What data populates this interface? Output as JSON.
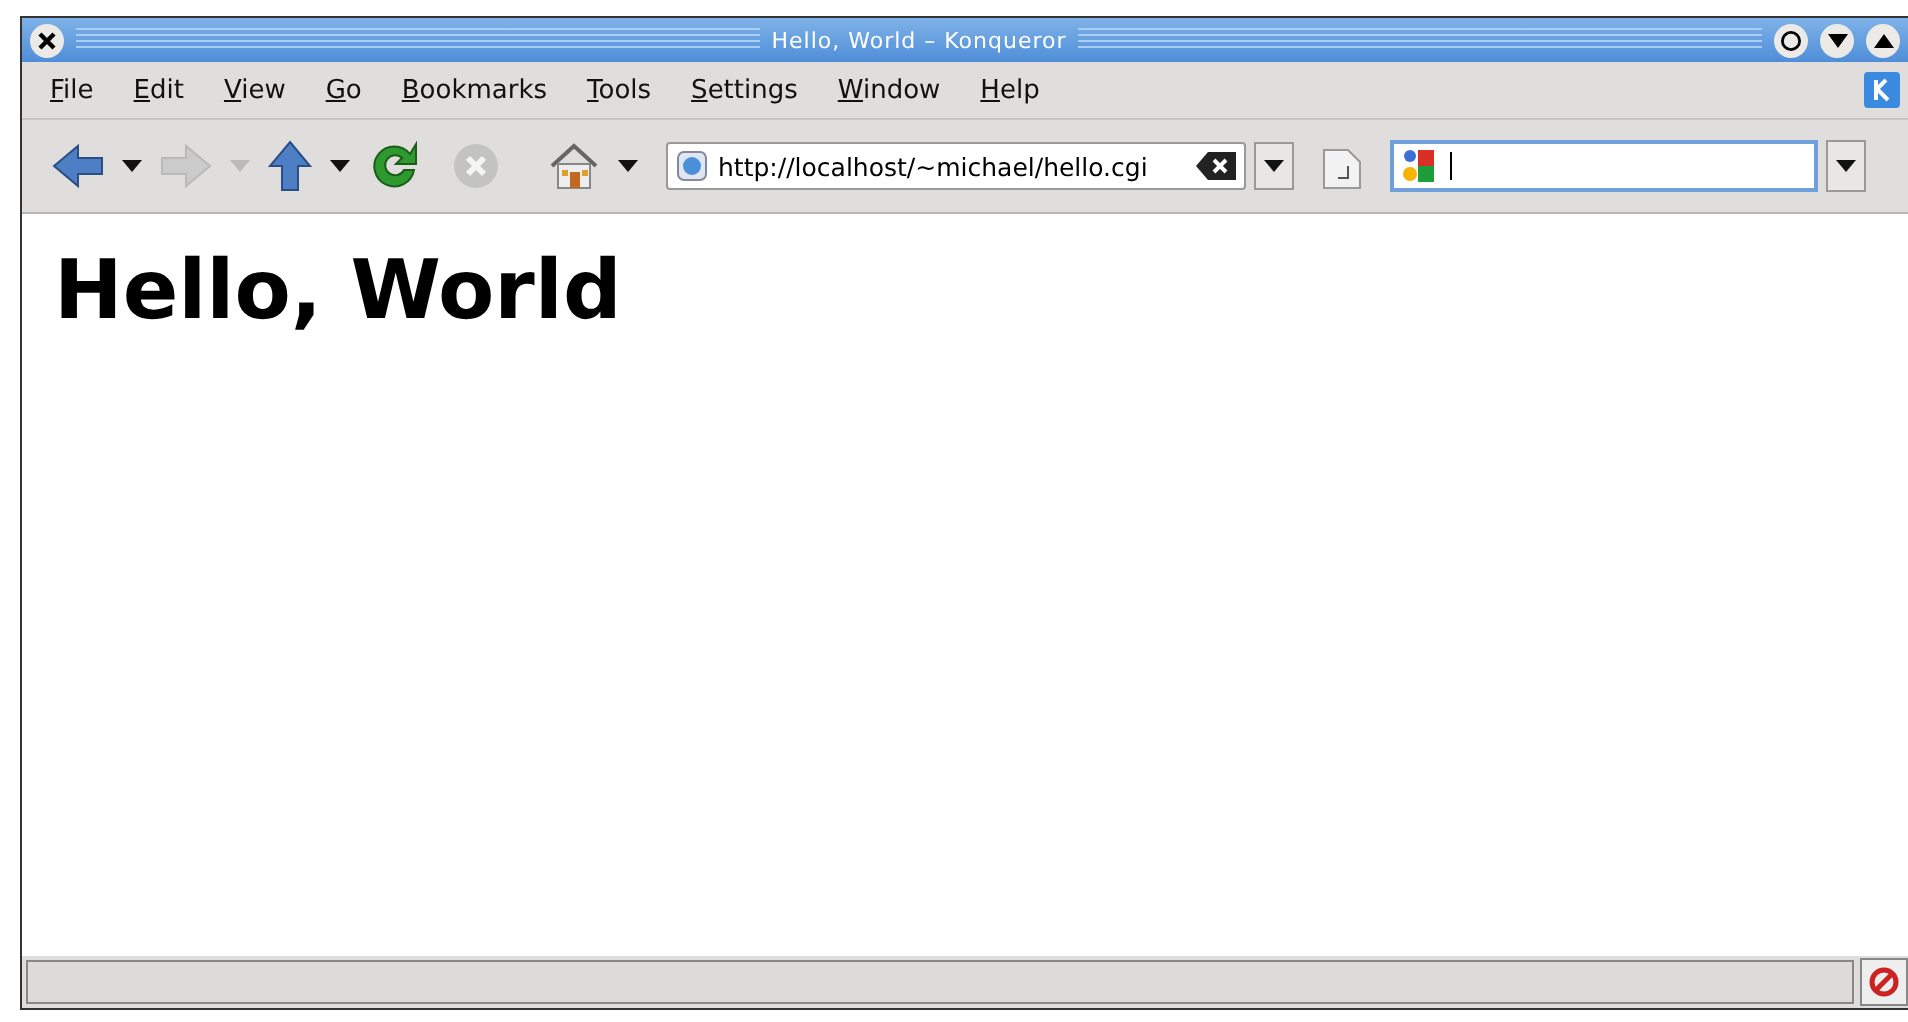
{
  "window": {
    "title": "Hello, World – Konqueror"
  },
  "menu": [
    {
      "label": "File"
    },
    {
      "label": "Edit"
    },
    {
      "label": "View"
    },
    {
      "label": "Go"
    },
    {
      "label": "Bookmarks"
    },
    {
      "label": "Tools"
    },
    {
      "label": "Settings"
    },
    {
      "label": "Window"
    },
    {
      "label": "Help"
    }
  ],
  "toolbar": [
    {
      "kind": "back",
      "disabled": false
    },
    {
      "kind": "forward",
      "disabled": true
    },
    {
      "kind": "up",
      "disabled": false
    },
    {
      "kind": "reload",
      "disabled": false
    },
    {
      "kind": "stop",
      "disabled": true
    },
    {
      "kind": "home",
      "disabled": false
    }
  ],
  "address": {
    "value": "http://localhost/~michael/hello.cgi"
  },
  "page": {
    "heading": "Hello, World"
  }
}
